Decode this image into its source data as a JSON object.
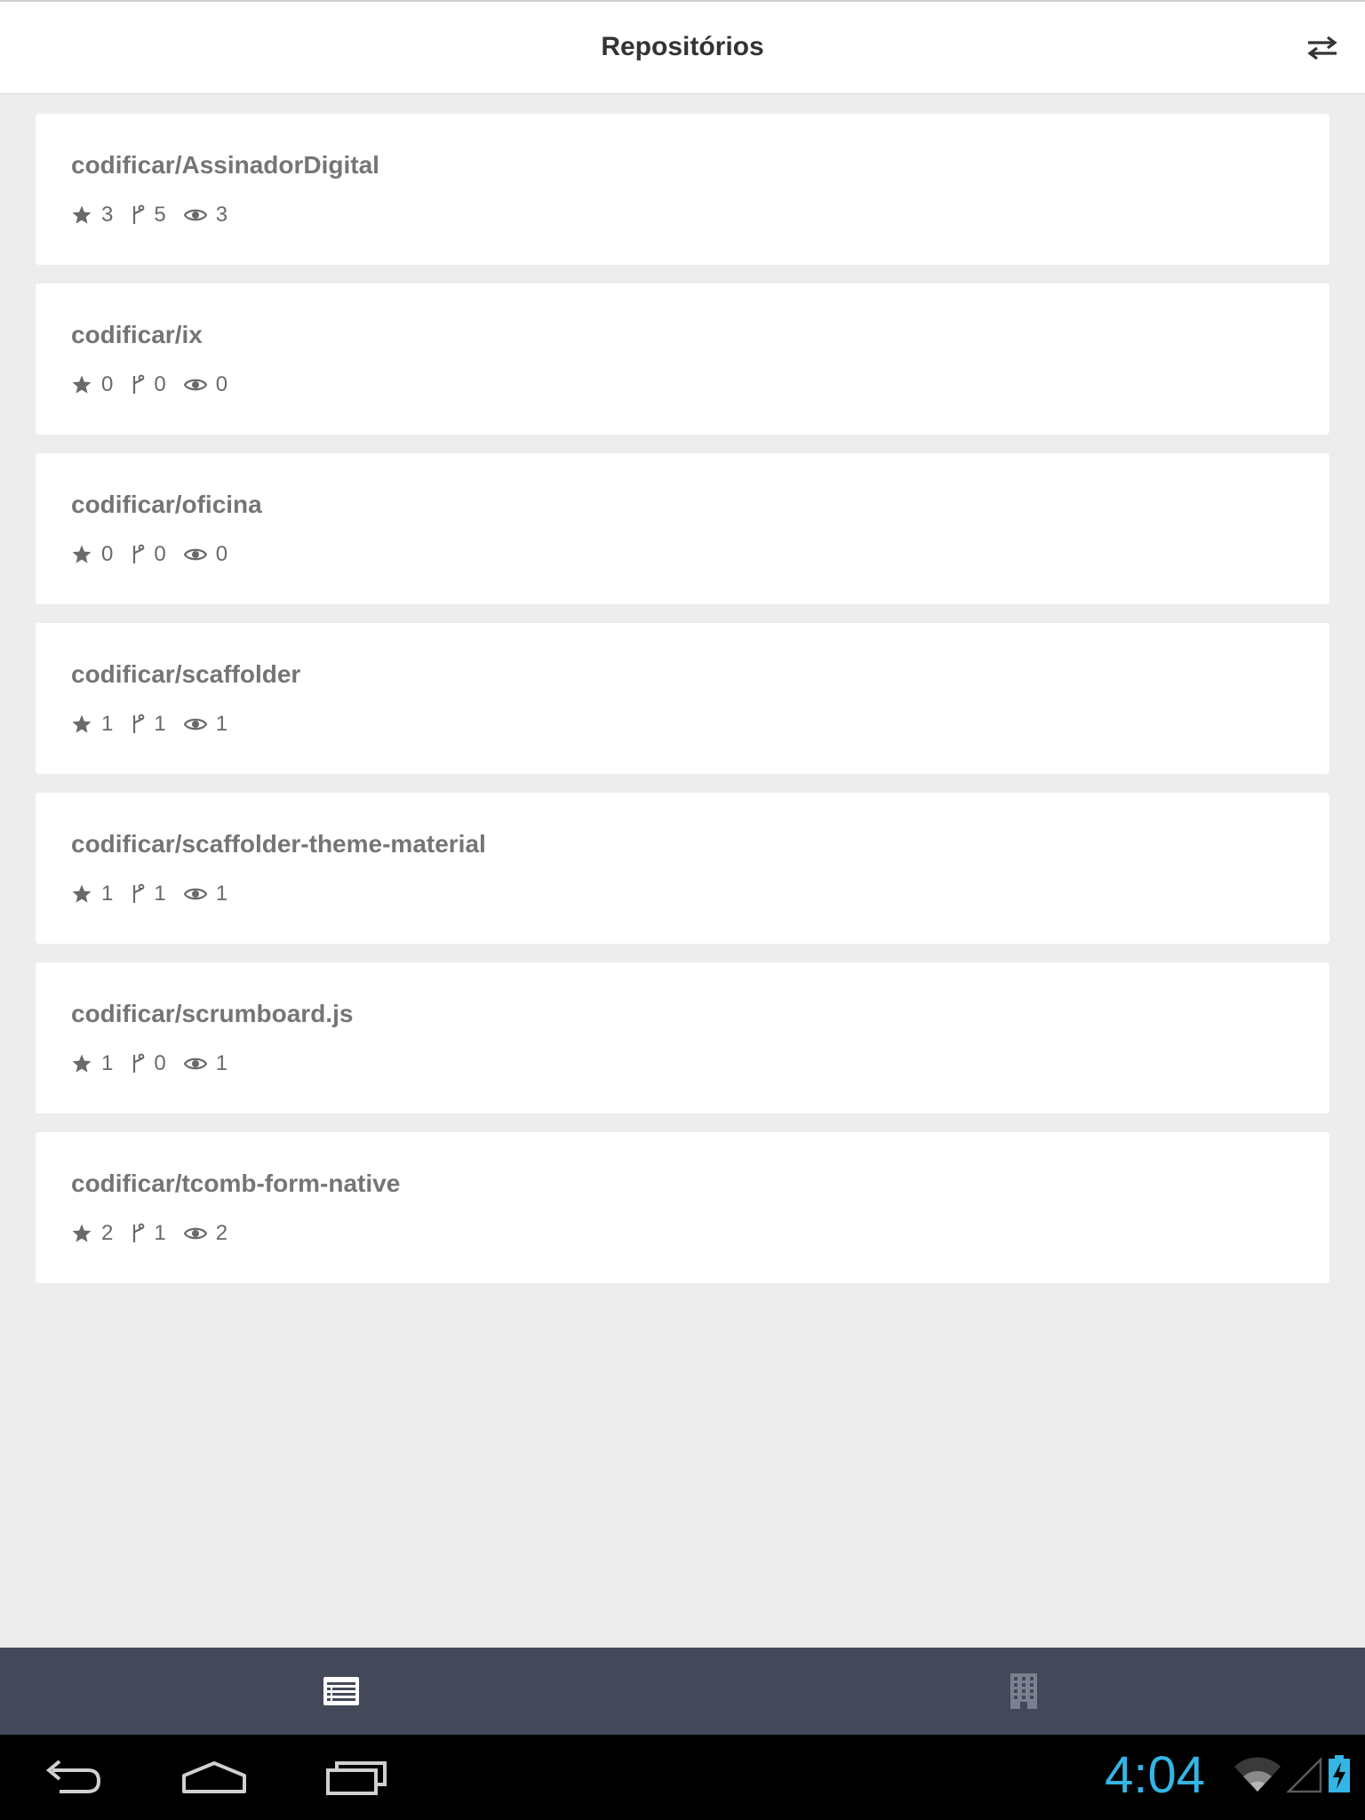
{
  "header": {
    "title": "Repositórios",
    "action_icon": "swap-arrows-icon"
  },
  "repos": [
    {
      "name": "codificar/AssinadorDigital",
      "stars": "3",
      "forks": "5",
      "watchers": "3"
    },
    {
      "name": "codificar/ix",
      "stars": "0",
      "forks": "0",
      "watchers": "0"
    },
    {
      "name": "codificar/oficina",
      "stars": "0",
      "forks": "0",
      "watchers": "0"
    },
    {
      "name": "codificar/scaffolder",
      "stars": "1",
      "forks": "1",
      "watchers": "1"
    },
    {
      "name": "codificar/scaffolder-theme-material",
      "stars": "1",
      "forks": "1",
      "watchers": "1"
    },
    {
      "name": "codificar/scrumboard.js",
      "stars": "1",
      "forks": "0",
      "watchers": "1"
    },
    {
      "name": "codificar/tcomb-form-native",
      "stars": "2",
      "forks": "1",
      "watchers": "2"
    }
  ],
  "tabs": [
    {
      "icon": "list-icon",
      "active": true
    },
    {
      "icon": "building-icon",
      "active": false
    }
  ],
  "system_bar": {
    "time": "4:04",
    "clock_color": "#33b5e5"
  },
  "colors": {
    "background": "#ededed",
    "card": "#ffffff",
    "tab_bar": "#434959",
    "text_secondary": "#757575"
  }
}
